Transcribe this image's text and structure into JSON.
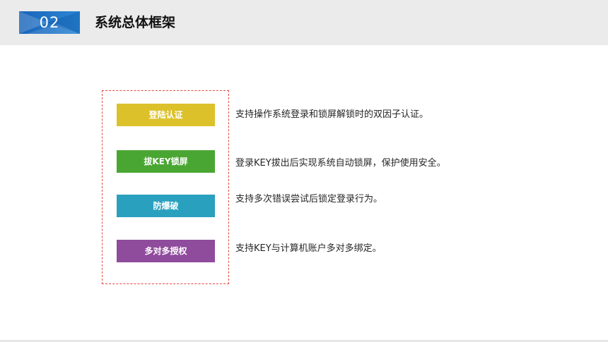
{
  "header": {
    "section_number": "02",
    "title": "系统总体框架"
  },
  "features": [
    {
      "label": "登陆认证",
      "description": "支持操作系统登录和锁屏解锁时的双因子认证。",
      "color": "#dcc12b"
    },
    {
      "label": "拔KEY锁屏",
      "description": "登录KEY拔出后实现系统自动锁屏，保护使用安全。",
      "color": "#4aa632"
    },
    {
      "label": "防爆破",
      "description": "支持多次错误尝试后锁定登录行为。",
      "color": "#2aa0bf"
    },
    {
      "label": "多对多授权",
      "description": "支持KEY与计算机账户多对多绑定。",
      "color": "#8f4b9c"
    }
  ],
  "colors": {
    "header_band": "#ebebeb",
    "badge_blue": "#2277c8",
    "frame_border": "#e3493f"
  }
}
